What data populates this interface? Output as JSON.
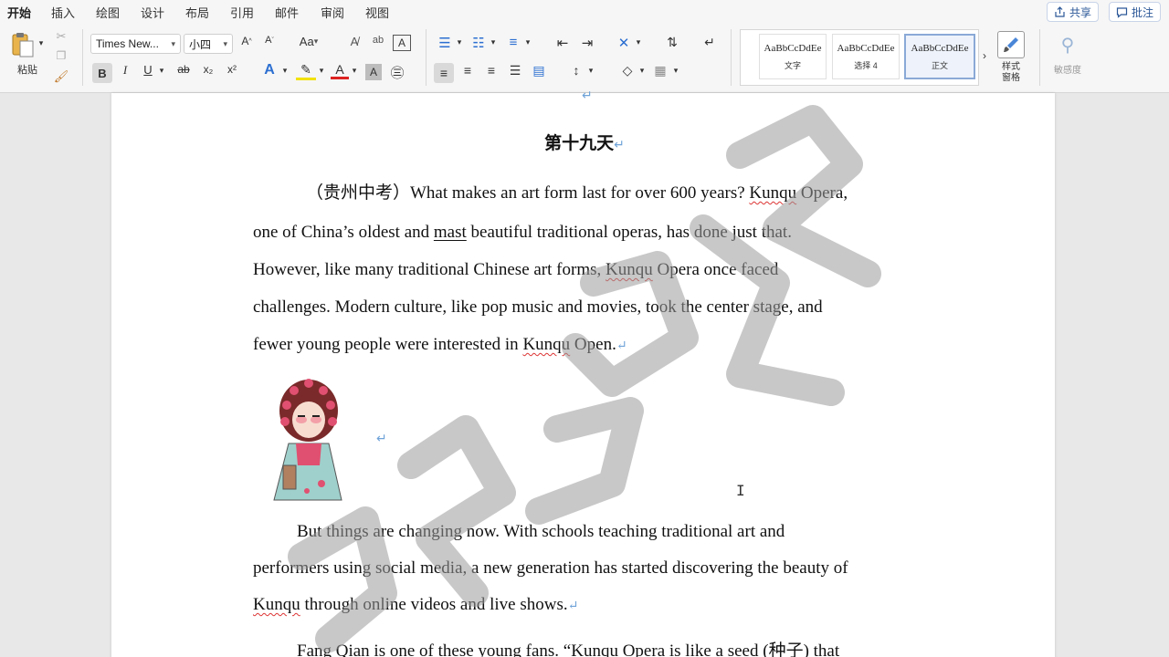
{
  "tabs": [
    "开始",
    "插入",
    "绘图",
    "设计",
    "布局",
    "引用",
    "邮件",
    "审阅",
    "视图"
  ],
  "share_label": "共享",
  "comment_label": "批注",
  "ribbon": {
    "paste_label": "粘贴",
    "font_name": "Times New...",
    "font_size": "小四",
    "case_label": "Aa",
    "styles": [
      {
        "preview": "AaBbCcDdEe",
        "name": "文字"
      },
      {
        "preview": "AaBbCcDdEe",
        "name": "选择 4"
      },
      {
        "preview": "AaBbCcDdEe",
        "name": "正文"
      }
    ],
    "style_pane_label": "样式\n窗格",
    "sensitivity_label": "敏感度",
    "bold": "B",
    "italic": "I",
    "underline": "U",
    "strike": "ab",
    "sub": "x₂",
    "sup": "x²"
  },
  "doc": {
    "title": "第十九天",
    "p1": {
      "l1a": "（贵州中考）What makes an art form last for over 600 years? ",
      "l1b": "Kunqu",
      " l1c": " Opera,",
      "l2a": "one of China’s oldest and ",
      "l2b": "mast",
      "l2c": " beautiful traditional operas, has done just that.",
      "l3a": "However, like many traditional Chinese art forms, ",
      "l3b": "Kunqu",
      "l3c": " Opera once faced",
      "l4": "challenges. Modern culture, like pop music and movies, took the center stage, and",
      "l5a": "fewer young people were interested in ",
      "l5b": "Kunqu",
      "l5c": " Open."
    },
    "p2": {
      "l1": "But things are changing now. With schools teaching traditional art and",
      "l2": "performers using social media, a new generation has started discovering the beauty of",
      "l3a": "Kunqu",
      "l3b": " through online videos and live shows."
    },
    "p3": {
      "l1": "Fang Qian is one of these young fans. “Kunqu Opera is like a seed (种子) that"
    },
    "para_mark": "↵"
  }
}
